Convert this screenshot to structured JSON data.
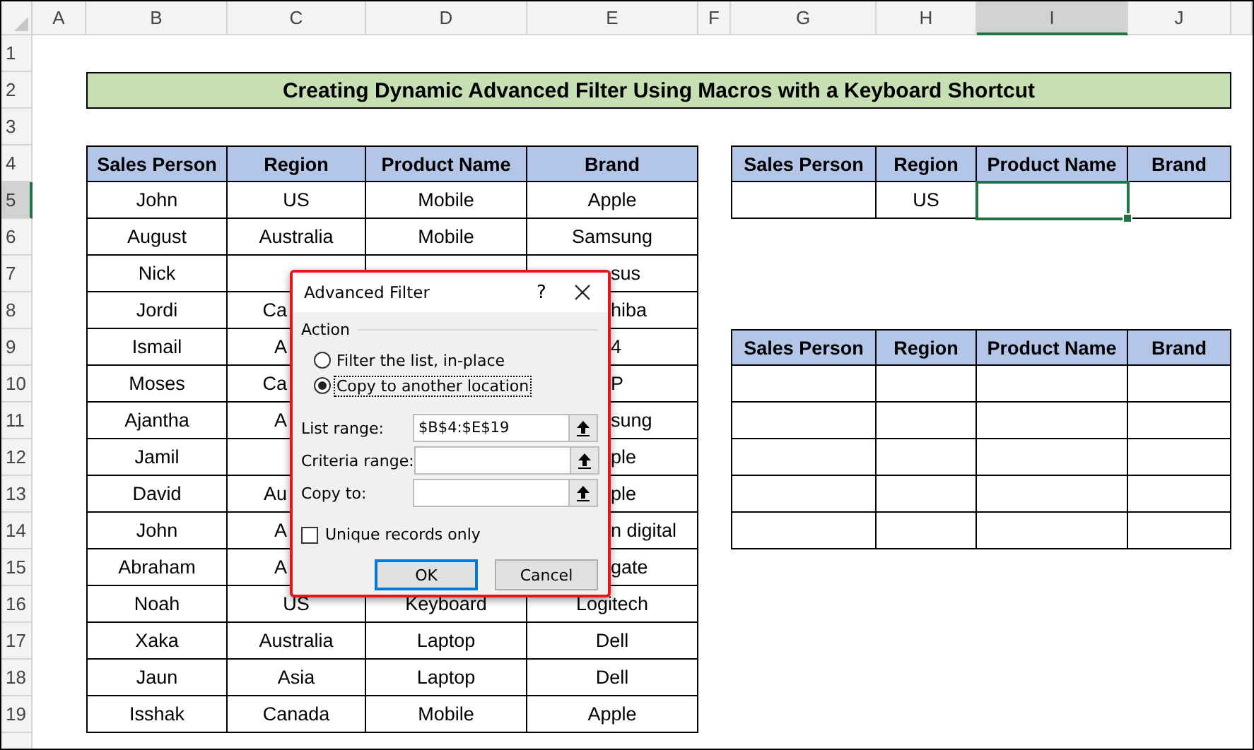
{
  "columns": [
    {
      "label": "A",
      "selected": false
    },
    {
      "label": "B",
      "selected": false
    },
    {
      "label": "C",
      "selected": false
    },
    {
      "label": "D",
      "selected": false
    },
    {
      "label": "E",
      "selected": false
    },
    {
      "label": "F",
      "selected": false
    },
    {
      "label": "G",
      "selected": false
    },
    {
      "label": "H",
      "selected": false
    },
    {
      "label": "I",
      "selected": true
    },
    {
      "label": "J",
      "selected": false
    }
  ],
  "rows": [
    {
      "label": "1",
      "selected": false
    },
    {
      "label": "2",
      "selected": false
    },
    {
      "label": "3",
      "selected": false
    },
    {
      "label": "4",
      "selected": false
    },
    {
      "label": "5",
      "selected": true
    },
    {
      "label": "6",
      "selected": false
    },
    {
      "label": "7",
      "selected": false
    },
    {
      "label": "8",
      "selected": false
    },
    {
      "label": "9",
      "selected": false
    },
    {
      "label": "10",
      "selected": false
    },
    {
      "label": "11",
      "selected": false
    },
    {
      "label": "12",
      "selected": false
    },
    {
      "label": "13",
      "selected": false
    },
    {
      "label": "14",
      "selected": false
    },
    {
      "label": "15",
      "selected": false
    },
    {
      "label": "16",
      "selected": false
    },
    {
      "label": "17",
      "selected": false
    },
    {
      "label": "18",
      "selected": false
    },
    {
      "label": "19",
      "selected": false
    }
  ],
  "title": "Creating Dynamic Advanced Filter Using Macros with a Keyboard Shortcut",
  "data_table": {
    "columns": [
      "Sales Person",
      "Region",
      "Product Name",
      "Brand"
    ],
    "rows": [
      [
        "John",
        "US",
        "Mobile",
        "Apple"
      ],
      [
        "August",
        "Australia",
        "Mobile",
        "Samsung"
      ],
      [
        "Nick",
        null,
        {
          "kind": "covered"
        },
        {
          "text": "sus",
          "kind": "right_part"
        }
      ],
      [
        "Jordi",
        {
          "text": "Ca",
          "kind": "left_part"
        },
        {
          "kind": "covered"
        },
        {
          "text": "hiba",
          "kind": "right_part"
        }
      ],
      [
        "Ismail",
        {
          "text": "A",
          "kind": "left_part"
        },
        {
          "kind": "covered"
        },
        {
          "text": "4",
          "kind": "right_part"
        }
      ],
      [
        "Moses",
        {
          "text": "Ca",
          "kind": "left_part"
        },
        {
          "kind": "covered"
        },
        {
          "text": "P",
          "kind": "right_part"
        }
      ],
      [
        "Ajantha",
        {
          "text": "A",
          "kind": "left_part"
        },
        {
          "kind": "covered"
        },
        {
          "text": "sung",
          "kind": "right_part"
        }
      ],
      [
        "Jamil",
        null,
        {
          "kind": "covered"
        },
        {
          "text": "ple",
          "kind": "right_part"
        }
      ],
      [
        "David",
        {
          "text": "Au",
          "kind": "left_part"
        },
        {
          "kind": "covered"
        },
        {
          "text": "ple",
          "kind": "right_part"
        }
      ],
      [
        "John",
        {
          "text": "A",
          "kind": "left_part"
        },
        {
          "kind": "covered"
        },
        {
          "text": "n digital",
          "kind": "right_part"
        }
      ],
      [
        "Abraham",
        {
          "text": "A",
          "kind": "left_part"
        },
        {
          "kind": "covered"
        },
        {
          "text": "gate",
          "kind": "right_part"
        }
      ],
      [
        "Noah",
        "US",
        "Keyboard",
        "Logitech"
      ],
      [
        "Xaka",
        "Australia",
        "Laptop",
        "Dell"
      ],
      [
        "Jaun",
        "Asia",
        "Laptop",
        "Dell"
      ],
      [
        "Isshak",
        "Canada",
        "Mobile",
        "Apple"
      ]
    ]
  },
  "criteria_table": {
    "columns": [
      "Sales Person",
      "Region",
      "Product Name",
      "Brand"
    ],
    "rows": [
      [
        null,
        "US",
        null,
        null
      ]
    ]
  },
  "output_table": {
    "columns": [
      "Sales Person",
      "Region",
      "Product Name",
      "Brand"
    ],
    "rows": [
      [
        null,
        null,
        null,
        null
      ],
      [
        null,
        null,
        null,
        null
      ],
      [
        null,
        null,
        null,
        null
      ],
      [
        null,
        null,
        null,
        null
      ],
      [
        null,
        null,
        null,
        null
      ]
    ]
  },
  "dialog": {
    "title": "Advanced Filter",
    "help": "?",
    "group": "Action",
    "options": [
      {
        "label": "Filter the list, in-place",
        "selected": false,
        "focused": false
      },
      {
        "label": "Copy to another location",
        "selected": true,
        "focused": true
      }
    ],
    "fields": [
      {
        "label": "List range:",
        "value": "$B$4:$E$19"
      },
      {
        "label": "Criteria range:"
      },
      {
        "label": "Copy to:"
      }
    ],
    "checkbox": {
      "label": "Unique records only",
      "checked": false
    },
    "buttons": [
      {
        "label": "OK",
        "default": true
      },
      {
        "label": "Cancel",
        "default": false
      }
    ]
  }
}
